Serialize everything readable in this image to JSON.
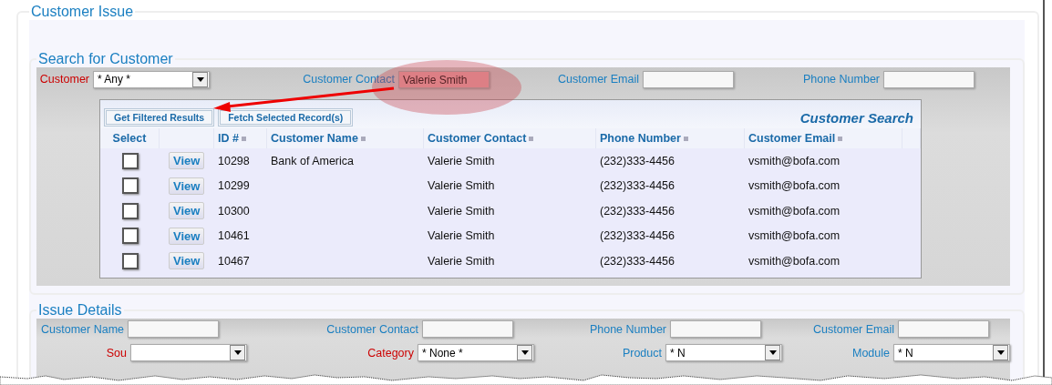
{
  "title": "Customer Issue",
  "search": {
    "title": "Search for Customer",
    "filters": [
      {
        "label": "Customer",
        "required": true,
        "kind": "select",
        "value": "* Any *"
      },
      {
        "label": "Customer Contact",
        "required": false,
        "kind": "text",
        "value": "Valerie Smith",
        "highlighted": true
      },
      {
        "label": "Customer Email",
        "required": false,
        "kind": "text",
        "highlighted": false
      },
      {
        "label": "Phone Number",
        "required": false,
        "kind": "text",
        "highlighted": false
      }
    ],
    "buttons": [
      "Get Filtered Results",
      "Fetch Selected Record(s)"
    ],
    "grid_title": "Customer Search",
    "columns": [
      "Select",
      "ID #",
      "Customer Name",
      "Customer Contact",
      "Phone Number",
      "Customer Email"
    ],
    "rows": [
      {
        "checked": false,
        "view": "View",
        "id": "10298",
        "name": "Bank of America",
        "contact": "Valerie Smith",
        "phone": "(232)333-4456",
        "email": "vsmith@bofa.com"
      },
      {
        "checked": false,
        "view": "View",
        "id": "10299",
        "contact": "Valerie Smith",
        "phone": "(232)333-4456",
        "email": "vsmith@bofa.com"
      },
      {
        "checked": false,
        "view": "View",
        "id": "10300",
        "contact": "Valerie Smith",
        "phone": "(232)333-4456",
        "email": "vsmith@bofa.com"
      },
      {
        "checked": false,
        "view": "View",
        "id": "10461",
        "contact": "Valerie Smith",
        "phone": "(232)333-4456",
        "email": "vsmith@bofa.com"
      },
      {
        "checked": false,
        "view": "View",
        "id": "10467",
        "contact": "Valerie Smith",
        "phone": "(232)333-4456",
        "email": "vsmith@bofa.com"
      }
    ]
  },
  "details": {
    "title": "Issue Details",
    "row_1": [
      {
        "label": "Customer Name",
        "required": false,
        "kind": "text"
      },
      {
        "label": "Customer Contact",
        "required": false,
        "kind": "text"
      },
      {
        "label": "Phone Number",
        "required": false,
        "kind": "text"
      },
      {
        "label": "Customer Email",
        "required": false,
        "kind": "text"
      }
    ],
    "row_2": [
      {
        "label": "Sou",
        "required": true,
        "kind": "select"
      },
      {
        "label": "Category",
        "required": true,
        "kind": "select",
        "value": "* None *"
      },
      {
        "label": "Product",
        "required": false,
        "kind": "select",
        "value": "* N"
      },
      {
        "label": "Module",
        "required": false,
        "kind": "select",
        "value": "* N"
      }
    ]
  }
}
